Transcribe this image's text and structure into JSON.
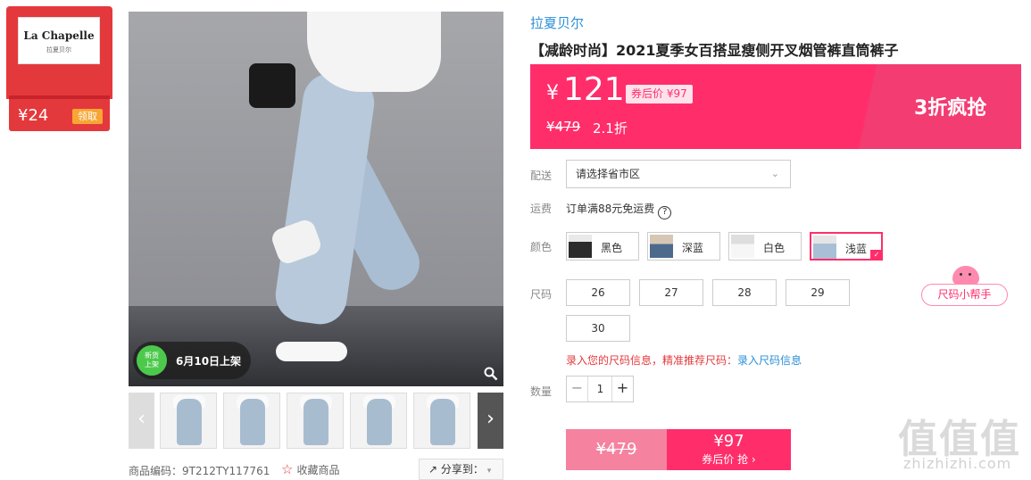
{
  "coupon": {
    "brand": "La Chapelle",
    "brand_sub": "拉夏贝尔",
    "amount": "¥24",
    "claim_label": "领取",
    "colors": {
      "bg": "#e4393c",
      "claim": "#f7a634"
    }
  },
  "gallery": {
    "new_badge_line1": "新货",
    "new_badge_line2": "上架",
    "new_text": "6月10日上架",
    "zoom_icon": "search-icon",
    "prev_arrow": "‹",
    "next_arrow": "›"
  },
  "meta": {
    "product_code": "商品编码：9T212TY117761",
    "favorite_label": "收藏商品",
    "share_label": "分享到："
  },
  "product": {
    "shop_name": "拉夏贝尔",
    "title": "【减龄时尚】2021夏季女百搭显瘦侧开叉烟管裤直筒裤子"
  },
  "price": {
    "currency": "¥",
    "current": "121",
    "after_coupon": "券后价 ¥97",
    "original": "¥479",
    "discount": "2.1折",
    "promo": "3折疯抢",
    "colors": {
      "accent": "#ff2e6b"
    }
  },
  "delivery": {
    "label": "配送",
    "placeholder": "请选择省市区"
  },
  "shipping": {
    "label": "运费",
    "value": "订单满88元免运费",
    "help_icon": "?"
  },
  "color_select": {
    "label": "颜色",
    "options": [
      {
        "name": "黑色"
      },
      {
        "name": "深蓝"
      },
      {
        "name": "白色"
      },
      {
        "name": "浅蓝",
        "selected": true
      }
    ]
  },
  "size_select": {
    "label": "尺码",
    "options": [
      "26",
      "27",
      "28",
      "29",
      "30"
    ],
    "help": "尺码小帮手",
    "tip": "录入您的尺码信息，精准推荐尺码：",
    "tip_link": "录入尺码信息"
  },
  "quantity": {
    "label": "数量",
    "value": "1",
    "minus": "−",
    "plus": "+"
  },
  "buy": {
    "original": "¥479",
    "price": "¥97",
    "label": "券后价 抢 ›"
  },
  "watermark": {
    "text": "值值值",
    "url": "zhizhizhi.com"
  }
}
